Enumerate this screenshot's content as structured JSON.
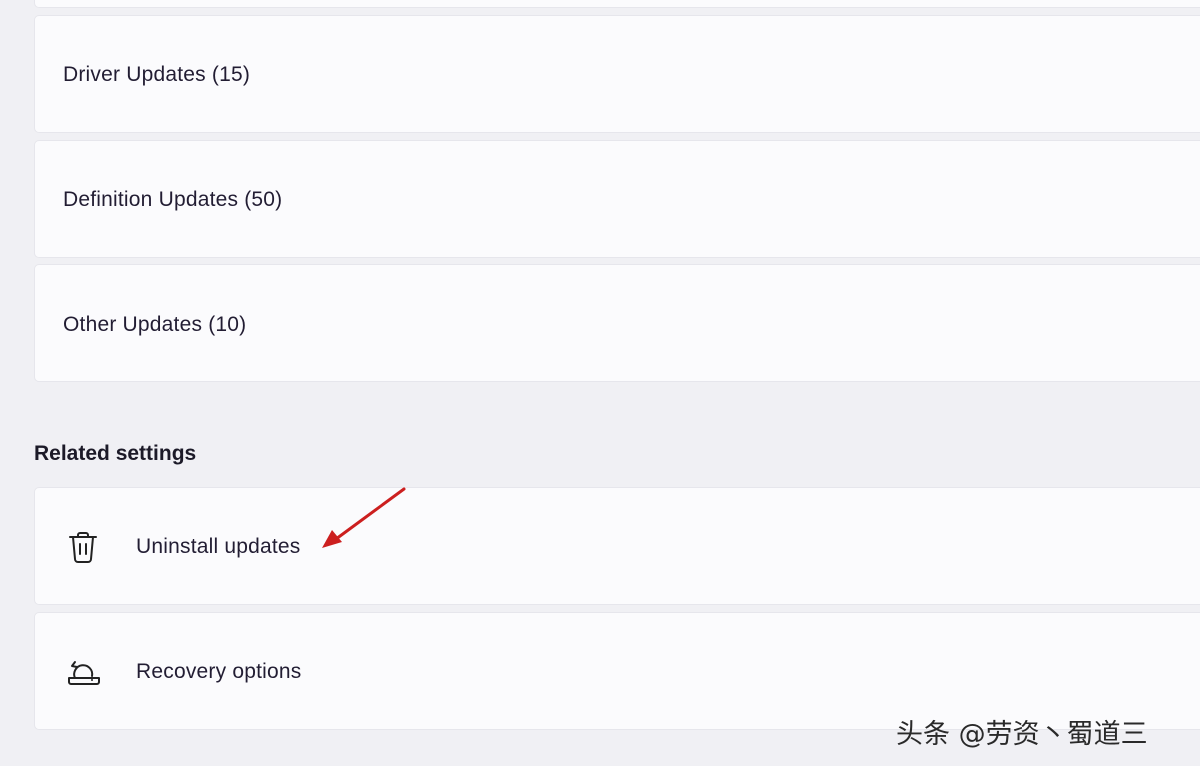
{
  "update_categories": [
    {
      "label": "Driver Updates (15)"
    },
    {
      "label": "Definition Updates (50)"
    },
    {
      "label": "Other Updates (10)"
    }
  ],
  "related_settings": {
    "heading": "Related settings",
    "items": [
      {
        "label": "Uninstall updates",
        "icon": "trash-icon"
      },
      {
        "label": "Recovery options",
        "icon": "recovery-icon"
      }
    ]
  },
  "annotation": {
    "arrow_color": "#cc1f1f"
  },
  "watermark": "头条 @劳资丶蜀道三"
}
